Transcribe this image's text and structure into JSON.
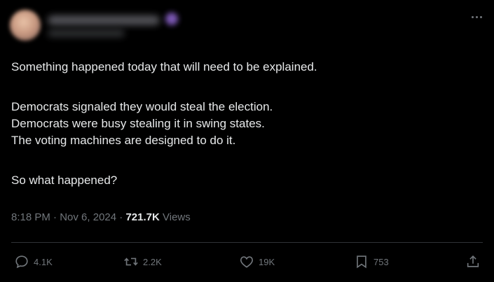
{
  "tweet": {
    "lines": [
      "Something happened today that will need to be explained.",
      "Democrats signaled they would steal the election.",
      "Democrats were busy stealing it in swing states.",
      "The voting machines are designed to do it.",
      "So what happened?"
    ],
    "time": "8:18 PM",
    "separator": "·",
    "date": "Nov 6, 2024",
    "views_count": "721.7K",
    "views_label": "Views"
  },
  "actions": {
    "reply_count": "4.1K",
    "retweet_count": "2.2K",
    "like_count": "19K",
    "bookmark_count": "753"
  },
  "icons": {
    "more": "more-horizontal-icon",
    "reply": "reply-icon",
    "retweet": "retweet-icon",
    "like": "heart-icon",
    "bookmark": "bookmark-icon",
    "share": "share-icon"
  },
  "colors": {
    "background": "#000000",
    "text": "#e7e9ea",
    "secondary": "#71767b",
    "divider": "#2f3336"
  }
}
